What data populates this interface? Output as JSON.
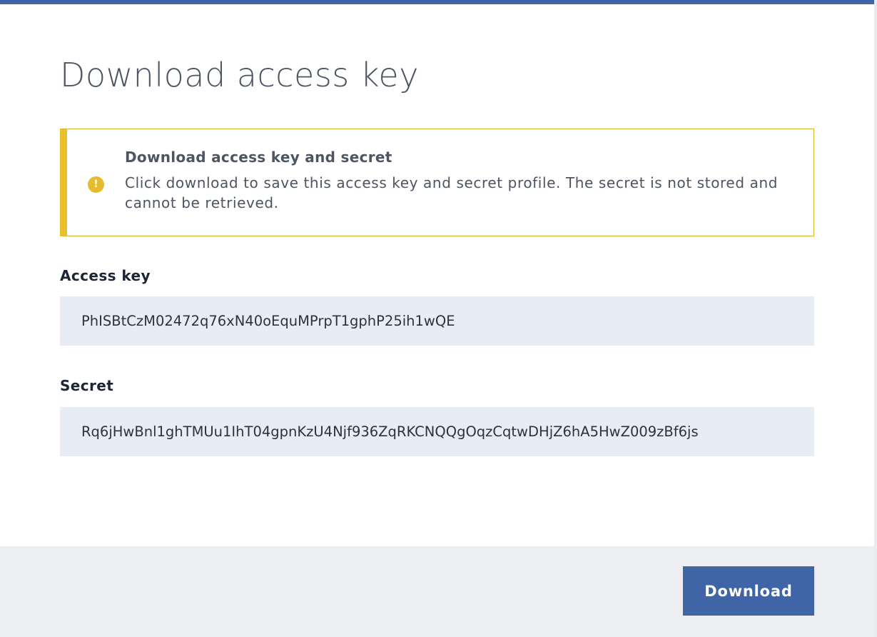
{
  "modal": {
    "title": "Download access key"
  },
  "notice": {
    "icon": "exclamation-icon",
    "icon_glyph": "!",
    "title": "Download access key and secret",
    "body": "Click download to save this access key and secret profile. The secret is not stored and cannot be retrieved."
  },
  "fields": {
    "access_key_label": "Access key",
    "access_key_value": "PhISBtCzM02472q76xN40oEquMPrpT1gphP25ih1wQE",
    "secret_label": "Secret",
    "secret_value": "Rq6jHwBnl1ghTMUu1IhT04gpnKzU4Njf936ZqRKCNQQgOqzCqtwDHjZ6hA5HwZ009zBf6js"
  },
  "footer": {
    "download_label": "Download"
  },
  "colors": {
    "accent": "#3f65a6",
    "warning": "#e9bf2e",
    "field_bg": "#e8edf5",
    "footer_bg": "#eceef1"
  }
}
